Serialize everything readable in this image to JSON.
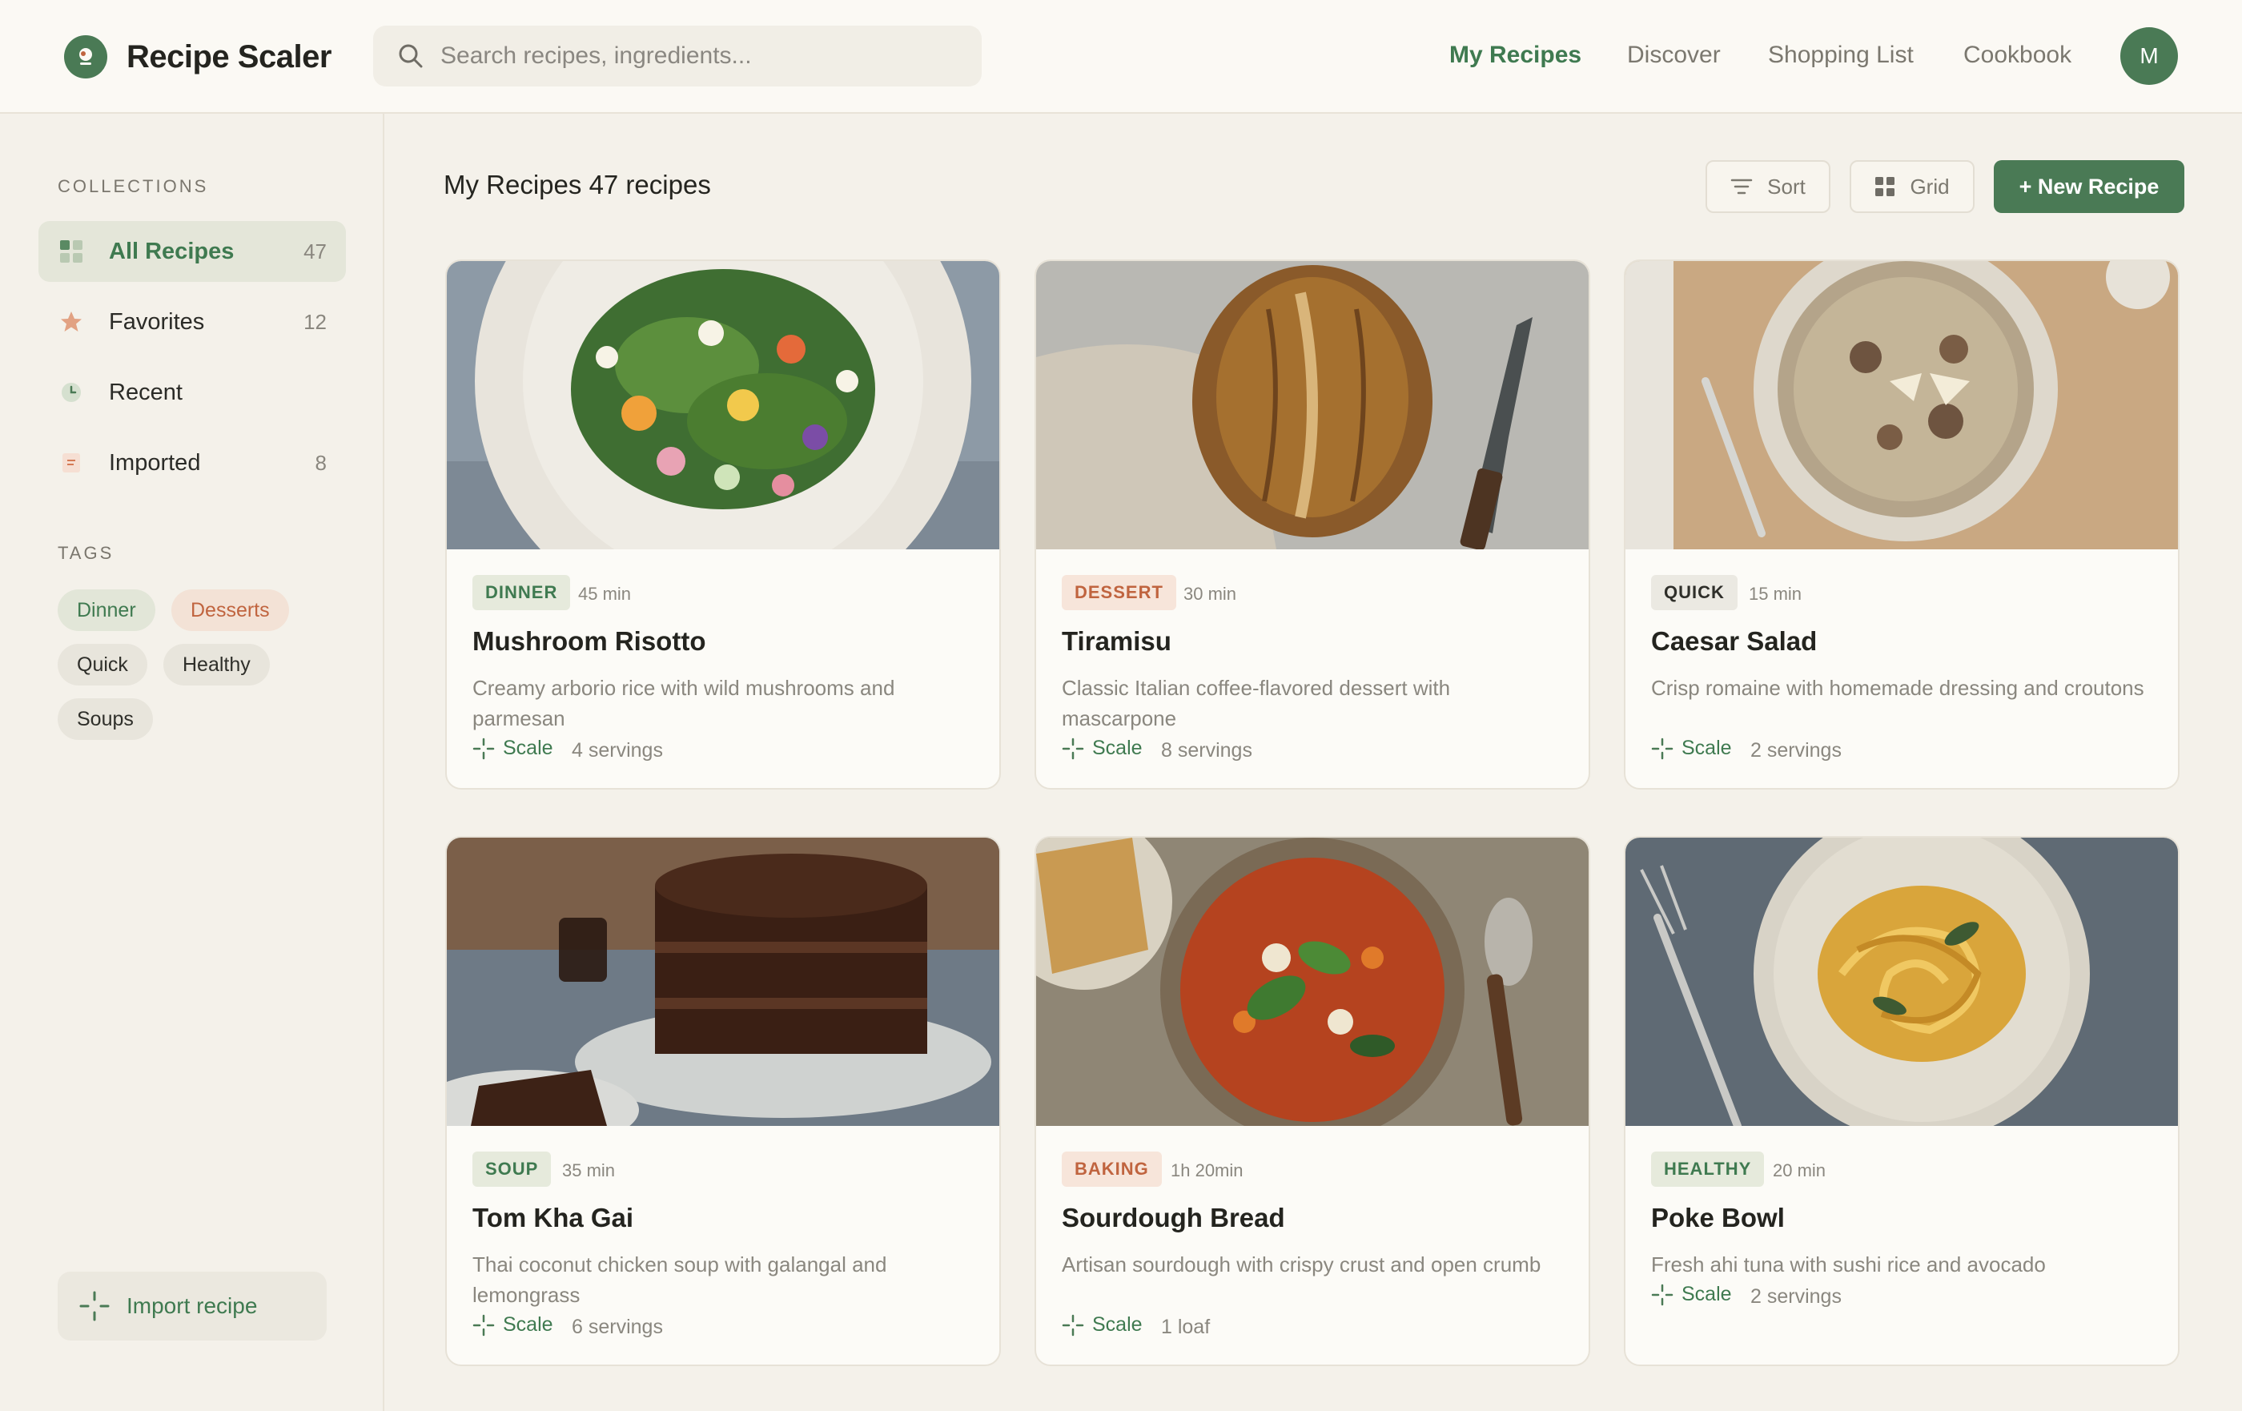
{
  "app": {
    "name": "Recipe Scaler",
    "avatar_initial": "M"
  },
  "search": {
    "placeholder": "Search recipes, ingredients..."
  },
  "nav": [
    {
      "label": "My Recipes",
      "active": true
    },
    {
      "label": "Discover",
      "active": false
    },
    {
      "label": "Shopping List",
      "active": false
    },
    {
      "label": "Cookbook",
      "active": false
    }
  ],
  "sidebar": {
    "collections_label": "COLLECTIONS",
    "collections": [
      {
        "label": "All Recipes",
        "count": "47",
        "icon": "grid-icon",
        "active": true
      },
      {
        "label": "Favorites",
        "count": "12",
        "icon": "star-icon",
        "active": false
      },
      {
        "label": "Recent",
        "count": "",
        "icon": "clock-icon",
        "active": false
      },
      {
        "label": "Imported",
        "count": "8",
        "icon": "document-icon",
        "active": false
      }
    ],
    "tags_label": "TAGS",
    "tags": [
      "Dinner",
      "Desserts",
      "Quick",
      "Healthy",
      "Soups"
    ],
    "import_label": "Import recipe"
  },
  "main": {
    "title": "My Recipes",
    "count": "47 recipes",
    "sort_label": "Sort",
    "grid_label": "Grid",
    "new_label": "+ New Recipe"
  },
  "recipes": [
    {
      "tag": "DINNER",
      "time": "45 min",
      "title": "Mushroom Risotto",
      "desc": "Creamy arborio rice with wild mushrooms and parmesan",
      "scale": "Scale",
      "servings": "4 servings",
      "photo": "flower-salad"
    },
    {
      "tag": "DESSERT",
      "time": "30 min",
      "title": "Tiramisu",
      "desc": "Classic Italian coffee-flavored dessert with mascarpone",
      "scale": "Scale",
      "servings": "8 servings",
      "photo": "bread-loaf"
    },
    {
      "tag": "QUICK",
      "time": "15 min",
      "title": "Caesar Salad",
      "desc": "Crisp romaine with homemade dressing and croutons",
      "scale": "Scale",
      "servings": "2 servings",
      "photo": "risotto-bowl"
    },
    {
      "tag": "SOUP",
      "time": "35 min",
      "title": "Tom Kha Gai",
      "desc": "Thai coconut chicken soup with galangal and lemongrass",
      "scale": "Scale",
      "servings": "6 servings",
      "photo": "chocolate-cake"
    },
    {
      "tag": "BAKING",
      "time": "1h 20min",
      "title": "Sourdough Bread",
      "desc": "Artisan sourdough with crispy crust and open crumb",
      "scale": "Scale",
      "servings": "1 loaf",
      "photo": "minestrone-bowl"
    },
    {
      "tag": "HEALTHY",
      "time": "20 min",
      "title": "Poke Bowl",
      "desc": "Fresh ahi tuna with sushi rice and avocado",
      "scale": "Scale",
      "servings": "2 servings",
      "photo": "pasta-plate"
    }
  ],
  "colors": {
    "accent": "#4a7a55",
    "peach": "#c0643f",
    "background": "#f4f1ea"
  }
}
